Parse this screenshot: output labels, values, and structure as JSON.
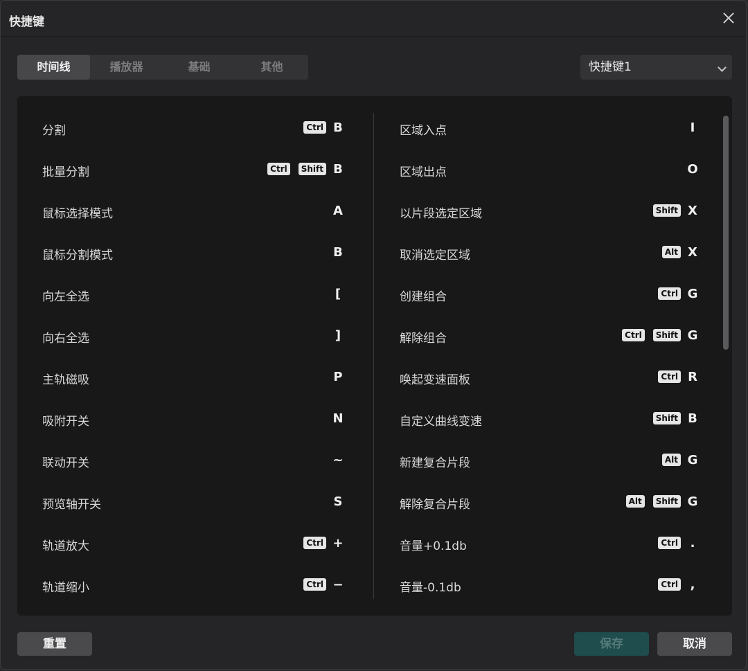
{
  "dialog": {
    "title": "快捷键"
  },
  "tabs": [
    {
      "label": "时间线",
      "active": true
    },
    {
      "label": "播放器",
      "active": false
    },
    {
      "label": "基础",
      "active": false
    },
    {
      "label": "其他",
      "active": false
    }
  ],
  "preset": {
    "selected": "快捷键1"
  },
  "left": [
    {
      "label": "分割",
      "mods": [
        "Ctrl"
      ],
      "key": "B"
    },
    {
      "label": "批量分割",
      "mods": [
        "Ctrl",
        "Shift"
      ],
      "key": "B"
    },
    {
      "label": "鼠标选择模式",
      "mods": [],
      "key": "A"
    },
    {
      "label": "鼠标分割模式",
      "mods": [],
      "key": "B"
    },
    {
      "label": "向左全选",
      "mods": [],
      "key": "["
    },
    {
      "label": "向右全选",
      "mods": [],
      "key": "]"
    },
    {
      "label": "主轨磁吸",
      "mods": [],
      "key": "P"
    },
    {
      "label": "吸附开关",
      "mods": [],
      "key": "N"
    },
    {
      "label": "联动开关",
      "mods": [],
      "key": "~"
    },
    {
      "label": "预览轴开关",
      "mods": [],
      "key": "S"
    },
    {
      "label": "轨道放大",
      "mods": [
        "Ctrl"
      ],
      "key": "+"
    },
    {
      "label": "轨道缩小",
      "mods": [
        "Ctrl"
      ],
      "key": "−"
    }
  ],
  "right": [
    {
      "label": "区域入点",
      "mods": [],
      "key": "I"
    },
    {
      "label": "区域出点",
      "mods": [],
      "key": "O"
    },
    {
      "label": "以片段选定区域",
      "mods": [
        "Shift"
      ],
      "key": "X"
    },
    {
      "label": "取消选定区域",
      "mods": [
        "Alt"
      ],
      "key": "X"
    },
    {
      "label": "创建组合",
      "mods": [
        "Ctrl"
      ],
      "key": "G"
    },
    {
      "label": "解除组合",
      "mods": [
        "Ctrl",
        "Shift"
      ],
      "key": "G"
    },
    {
      "label": "唤起变速面板",
      "mods": [
        "Ctrl"
      ],
      "key": "R"
    },
    {
      "label": "自定义曲线变速",
      "mods": [
        "Shift"
      ],
      "key": "B"
    },
    {
      "label": "新建复合片段",
      "mods": [
        "Alt"
      ],
      "key": "G"
    },
    {
      "label": "解除复合片段",
      "mods": [
        "Alt",
        "Shift"
      ],
      "key": "G"
    },
    {
      "label": "音量+0.1db",
      "mods": [
        "Ctrl"
      ],
      "key": "."
    },
    {
      "label": "音量-0.1db",
      "mods": [
        "Ctrl"
      ],
      "key": ","
    }
  ],
  "buttons": {
    "reset": "重置",
    "save": "保存",
    "cancel": "取消"
  }
}
